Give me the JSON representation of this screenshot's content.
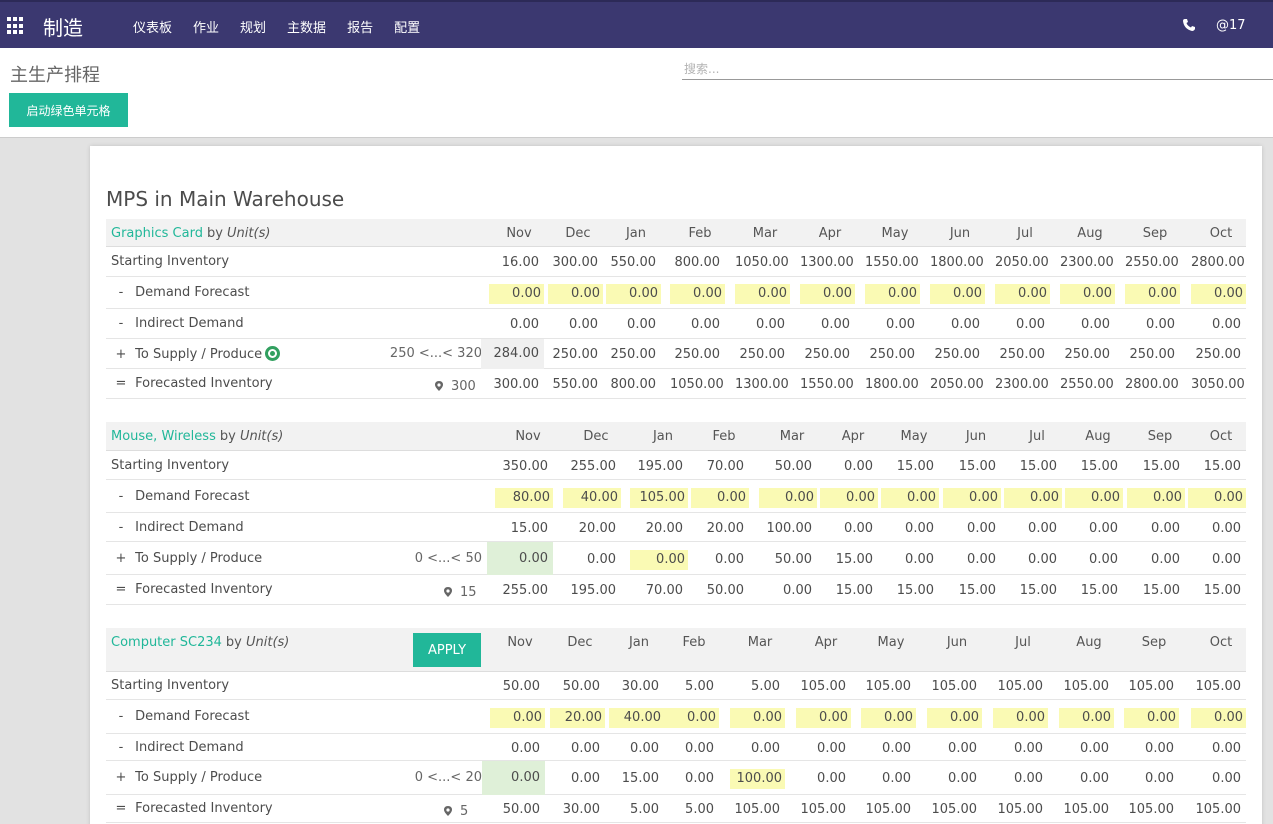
{
  "navbar": {
    "app_title": "制造",
    "menu": [
      "仪表板",
      "作业",
      "规划",
      "主数据",
      "报告",
      "配置"
    ],
    "mention_count": "@17",
    "bg_color": "#3b3870"
  },
  "control": {
    "title": "主生产排程",
    "search_placeholder": "搜索...",
    "green_cells_button": "启动绿色单元格"
  },
  "mps": {
    "title": "MPS in Main Warehouse",
    "by_label": "by",
    "uom": "Unit(s)",
    "row_labels": {
      "starting": "Starting Inventory",
      "demand_op": "-",
      "demand": "Demand Forecast",
      "indirect_op": "-",
      "indirect": "Indirect Demand",
      "supply_op": "+",
      "supply": "To Supply / Produce",
      "forecast_op": "=",
      "forecast": "Forecasted Inventory"
    },
    "months": [
      "Nov",
      "Dec",
      "Jan",
      "Feb",
      "Mar",
      "Apr",
      "May",
      "Jun",
      "Jul",
      "Aug",
      "Sep",
      "Oct"
    ],
    "apply_label": "APPLY",
    "products": [
      {
        "name": "Graphics Card",
        "range": "250 <...< 320",
        "safety_stock": "300",
        "starting": [
          "16.00",
          "300.00",
          "550.00",
          "800.00",
          "1050.00",
          "1300.00",
          "1550.00",
          "1800.00",
          "2050.00",
          "2300.00",
          "2550.00",
          "2800.00"
        ],
        "demand": [
          "0.00",
          "0.00",
          "0.00",
          "0.00",
          "0.00",
          "0.00",
          "0.00",
          "0.00",
          "0.00",
          "0.00",
          "0.00",
          "0.00"
        ],
        "indirect": [
          "0.00",
          "0.00",
          "0.00",
          "0.00",
          "0.00",
          "0.00",
          "0.00",
          "0.00",
          "0.00",
          "0.00",
          "0.00",
          "0.00"
        ],
        "supply": [
          "284.00",
          "250.00",
          "250.00",
          "250.00",
          "250.00",
          "250.00",
          "250.00",
          "250.00",
          "250.00",
          "250.00",
          "250.00",
          "250.00"
        ],
        "forecast": [
          "300.00",
          "550.00",
          "800.00",
          "1050.00",
          "1300.00",
          "1550.00",
          "1800.00",
          "2050.00",
          "2300.00",
          "2550.00",
          "2800.00",
          "3050.00"
        ]
      },
      {
        "name": "Mouse, Wireless",
        "range": "0 <...< 50",
        "safety_stock": "15",
        "starting": [
          "350.00",
          "255.00",
          "195.00",
          "70.00",
          "50.00",
          "0.00",
          "15.00",
          "15.00",
          "15.00",
          "15.00",
          "15.00",
          "15.00"
        ],
        "demand": [
          "80.00",
          "40.00",
          "105.00",
          "0.00",
          "0.00",
          "0.00",
          "0.00",
          "0.00",
          "0.00",
          "0.00",
          "0.00",
          "0.00"
        ],
        "indirect": [
          "15.00",
          "20.00",
          "20.00",
          "20.00",
          "100.00",
          "0.00",
          "0.00",
          "0.00",
          "0.00",
          "0.00",
          "0.00",
          "0.00"
        ],
        "supply": [
          "0.00",
          "0.00",
          "0.00",
          "0.00",
          "50.00",
          "15.00",
          "0.00",
          "0.00",
          "0.00",
          "0.00",
          "0.00",
          "0.00"
        ],
        "forecast": [
          "255.00",
          "195.00",
          "70.00",
          "50.00",
          "0.00",
          "15.00",
          "15.00",
          "15.00",
          "15.00",
          "15.00",
          "15.00",
          "15.00"
        ]
      },
      {
        "name": "Computer SC234",
        "range": "0 <...< 20",
        "safety_stock": "5",
        "starting": [
          "50.00",
          "50.00",
          "30.00",
          "5.00",
          "5.00",
          "105.00",
          "105.00",
          "105.00",
          "105.00",
          "105.00",
          "105.00",
          "105.00"
        ],
        "demand": [
          "0.00",
          "20.00",
          "40.00",
          "0.00",
          "0.00",
          "0.00",
          "0.00",
          "0.00",
          "0.00",
          "0.00",
          "0.00",
          "0.00"
        ],
        "indirect": [
          "0.00",
          "0.00",
          "0.00",
          "0.00",
          "0.00",
          "0.00",
          "0.00",
          "0.00",
          "0.00",
          "0.00",
          "0.00",
          "0.00"
        ],
        "supply": [
          "0.00",
          "0.00",
          "15.00",
          "0.00",
          "100.00",
          "0.00",
          "0.00",
          "0.00",
          "0.00",
          "0.00",
          "0.00",
          "0.00"
        ],
        "forecast": [
          "50.00",
          "30.00",
          "5.00",
          "5.00",
          "105.00",
          "105.00",
          "105.00",
          "105.00",
          "105.00",
          "105.00",
          "105.00",
          "105.00"
        ]
      }
    ]
  }
}
